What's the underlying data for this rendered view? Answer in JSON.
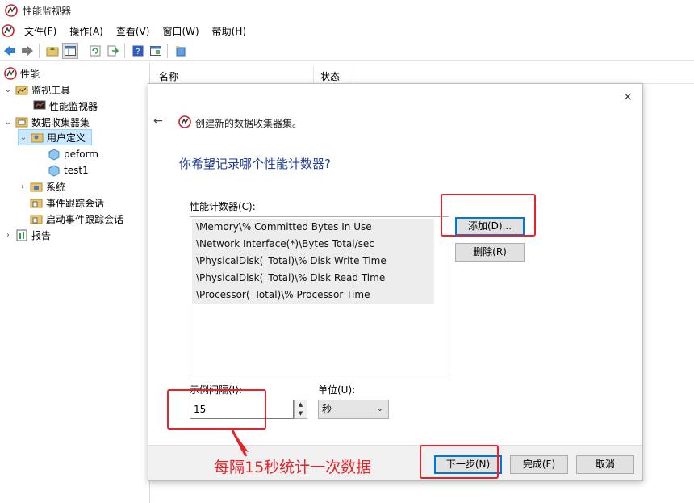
{
  "window": {
    "title": "性能监视器"
  },
  "menu": [
    "文件(F)",
    "操作(A)",
    "查看(V)",
    "窗口(W)",
    "帮助(H)"
  ],
  "toolbar": {
    "icons": [
      "back-icon",
      "forward-icon",
      "up-folder-icon",
      "console-tree-icon",
      "refresh-icon",
      "export-icon",
      "help-icon",
      "properties-icon",
      "new-icon"
    ]
  },
  "tree": {
    "root": "性能",
    "monitoring_tools": "监视工具",
    "perf_monitor": "性能监视器",
    "data_collector_sets": "数据收集器集",
    "user_defined": "用户定义",
    "peform": "peform",
    "test1": "test1",
    "system": "系统",
    "event_trace": "事件跟踪会话",
    "startup_event_trace": "启动事件跟踪会话",
    "reports": "报告"
  },
  "list": {
    "col_name": "名称",
    "col_status": "状态"
  },
  "dialog": {
    "close": "×",
    "back": "←",
    "title": "创建新的数据收集器集。",
    "question": "你希望记录哪个性能计数器?",
    "counters_label": "性能计数器(C):",
    "counters": [
      "\\Memory\\% Committed Bytes In Use",
      "\\Network Interface(*)\\Bytes Total/sec",
      "\\PhysicalDisk(_Total)\\% Disk Write Time",
      "\\PhysicalDisk(_Total)\\% Disk Read Time",
      "\\Processor(_Total)\\% Processor Time"
    ],
    "add_button": "添加(D)...",
    "remove_button": "删除(R)",
    "interval_label": "示例间隔(I):",
    "interval_value": "15",
    "unit_label": "单位(U):",
    "unit_value": "秒",
    "next_button": "下一步(N)",
    "finish_button": "完成(F)",
    "cancel_button": "取消"
  },
  "annotation": {
    "text": "每隔15秒统计一次数据",
    "color": "#e6222a"
  }
}
